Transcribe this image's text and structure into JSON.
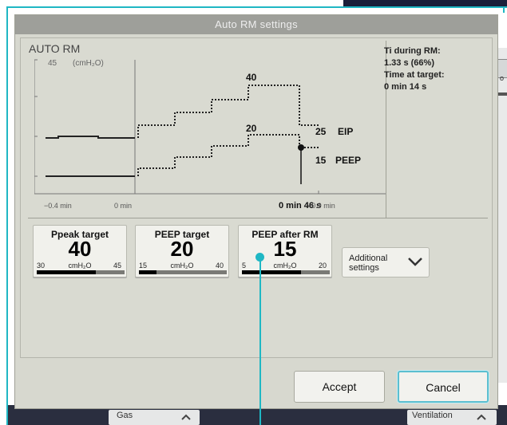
{
  "dialog": {
    "title": "Auto RM settings",
    "chart": {
      "title": "AUTO RM",
      "y_max_label": "45",
      "y_unit_label": "(cmH₂O)",
      "x_labels": [
        "−0.4 min",
        "0 min",
        "+0.9 min"
      ],
      "eip_peak": "40",
      "eip_end_value": "25",
      "eip_label": "EIP",
      "peep_peak": "20",
      "peep_end_value": "15",
      "peep_label": "PEEP",
      "marker_time": "0 min 46 s"
    },
    "info": {
      "ti_label": "Ti during RM:",
      "ti_value": "1.33 s  (66%)",
      "time_label": "Time at target:",
      "time_value": "0 min 14 s"
    },
    "tiles": [
      {
        "label": "Ppeak target",
        "value": "40",
        "unit": "cmH₂O",
        "min": "30",
        "max": "45",
        "fraction": 0.67
      },
      {
        "label": "PEEP target",
        "value": "20",
        "unit": "cmH₂O",
        "min": "15",
        "max": "40",
        "fraction": 0.2
      },
      {
        "label": "PEEP after RM",
        "value": "15",
        "unit": "cmH₂O",
        "min": "5",
        "max": "20",
        "fraction": 0.67
      }
    ],
    "additional_settings": "Additional settings",
    "accept_label": "Accept",
    "cancel_label": "Cancel"
  },
  "background": {
    "right_label": "o",
    "bottom_left_label": "Gas",
    "bottom_right_label": "Ventilation"
  },
  "colors": {
    "dialog_bg": "#d7d8cf",
    "title_bar": "#9e9f9a",
    "accent_teal": "#1fb7c4",
    "focus_border": "#5bbfd0"
  }
}
